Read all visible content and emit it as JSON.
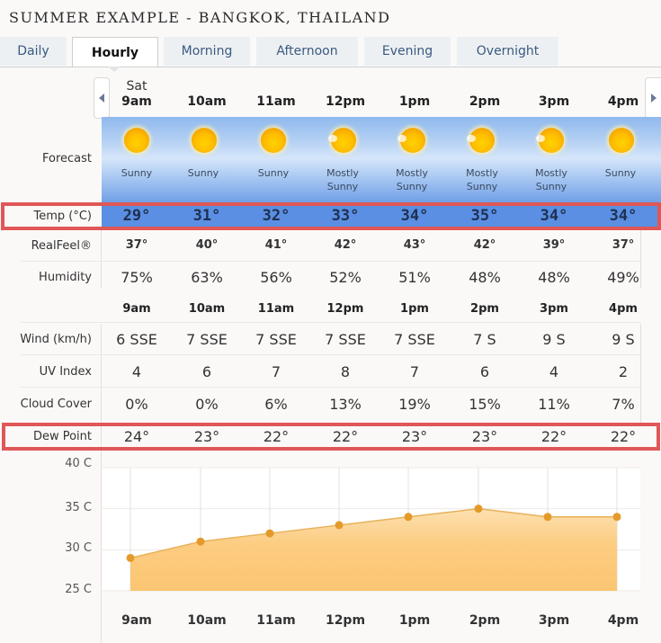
{
  "title": "SUMMER EXAMPLE - BANGKOK, THAILAND",
  "tabs": [
    {
      "label": "Daily",
      "active": false
    },
    {
      "label": "Hourly",
      "active": true
    },
    {
      "label": "Morning",
      "active": false
    },
    {
      "label": "Afternoon",
      "active": false
    },
    {
      "label": "Evening",
      "active": false
    },
    {
      "label": "Overnight",
      "active": false
    }
  ],
  "nav": {
    "prev_icon": "chevron-left-icon",
    "next_icon": "chevron-right-icon"
  },
  "day": "Sat",
  "hours": [
    "9am",
    "10am",
    "11am",
    "12pm",
    "1pm",
    "2pm",
    "3pm",
    "4pm"
  ],
  "labels": {
    "forecast": "Forecast",
    "temp": "Temp (°C)",
    "realfeel": "RealFeel®",
    "humidity": "Humidity",
    "wind": "Wind (km/h)",
    "uv": "UV Index",
    "cloud": "Cloud Cover",
    "dew": "Dew Point"
  },
  "forecast": [
    {
      "icon": "sunny-icon",
      "line1": "Sunny",
      "line2": ""
    },
    {
      "icon": "sunny-icon",
      "line1": "Sunny",
      "line2": ""
    },
    {
      "icon": "sunny-icon",
      "line1": "Sunny",
      "line2": ""
    },
    {
      "icon": "mostly-sunny-icon",
      "line1": "Mostly",
      "line2": "Sunny"
    },
    {
      "icon": "mostly-sunny-icon",
      "line1": "Mostly",
      "line2": "Sunny"
    },
    {
      "icon": "mostly-sunny-icon",
      "line1": "Mostly",
      "line2": "Sunny"
    },
    {
      "icon": "mostly-sunny-icon",
      "line1": "Mostly",
      "line2": "Sunny"
    },
    {
      "icon": "sunny-icon",
      "line1": "Sunny",
      "line2": ""
    }
  ],
  "temp": [
    "29°",
    "31°",
    "32°",
    "33°",
    "34°",
    "35°",
    "34°",
    "34°"
  ],
  "realfeel": [
    "37°",
    "40°",
    "41°",
    "42°",
    "43°",
    "42°",
    "39°",
    "37°"
  ],
  "humidity": [
    "75%",
    "63%",
    "56%",
    "52%",
    "51%",
    "48%",
    "48%",
    "49%"
  ],
  "wind": [
    "6 SSE",
    "7 SSE",
    "7 SSE",
    "7 SSE",
    "7 SSE",
    "7 S",
    "9 S",
    "9 S"
  ],
  "uv": [
    "4",
    "6",
    "7",
    "8",
    "7",
    "6",
    "4",
    "2"
  ],
  "cloud": [
    "0%",
    "0%",
    "6%",
    "13%",
    "19%",
    "15%",
    "11%",
    "7%"
  ],
  "dew": [
    "24°",
    "23°",
    "22°",
    "22°",
    "23°",
    "23°",
    "22°",
    "22°"
  ],
  "colors": {
    "highlight": "#e05757",
    "temp_band": "#5b8fe3",
    "chart_fill": "#fbc97a",
    "chart_line": "#e49a2a"
  },
  "chart_data": {
    "type": "area",
    "title": "",
    "xlabel": "",
    "ylabel": "",
    "categories": [
      "9am",
      "10am",
      "11am",
      "12pm",
      "1pm",
      "2pm",
      "3pm",
      "4pm"
    ],
    "series": [
      {
        "name": "Temp (°C)",
        "values": [
          29,
          31,
          32,
          33,
          34,
          35,
          34,
          34
        ]
      }
    ],
    "yticks": [
      25,
      30,
      35,
      40
    ],
    "ytick_labels": [
      "25 C",
      "30 C",
      "35 C",
      "40 C"
    ],
    "ylim": [
      25,
      40
    ],
    "grid": true,
    "legend": "none"
  }
}
